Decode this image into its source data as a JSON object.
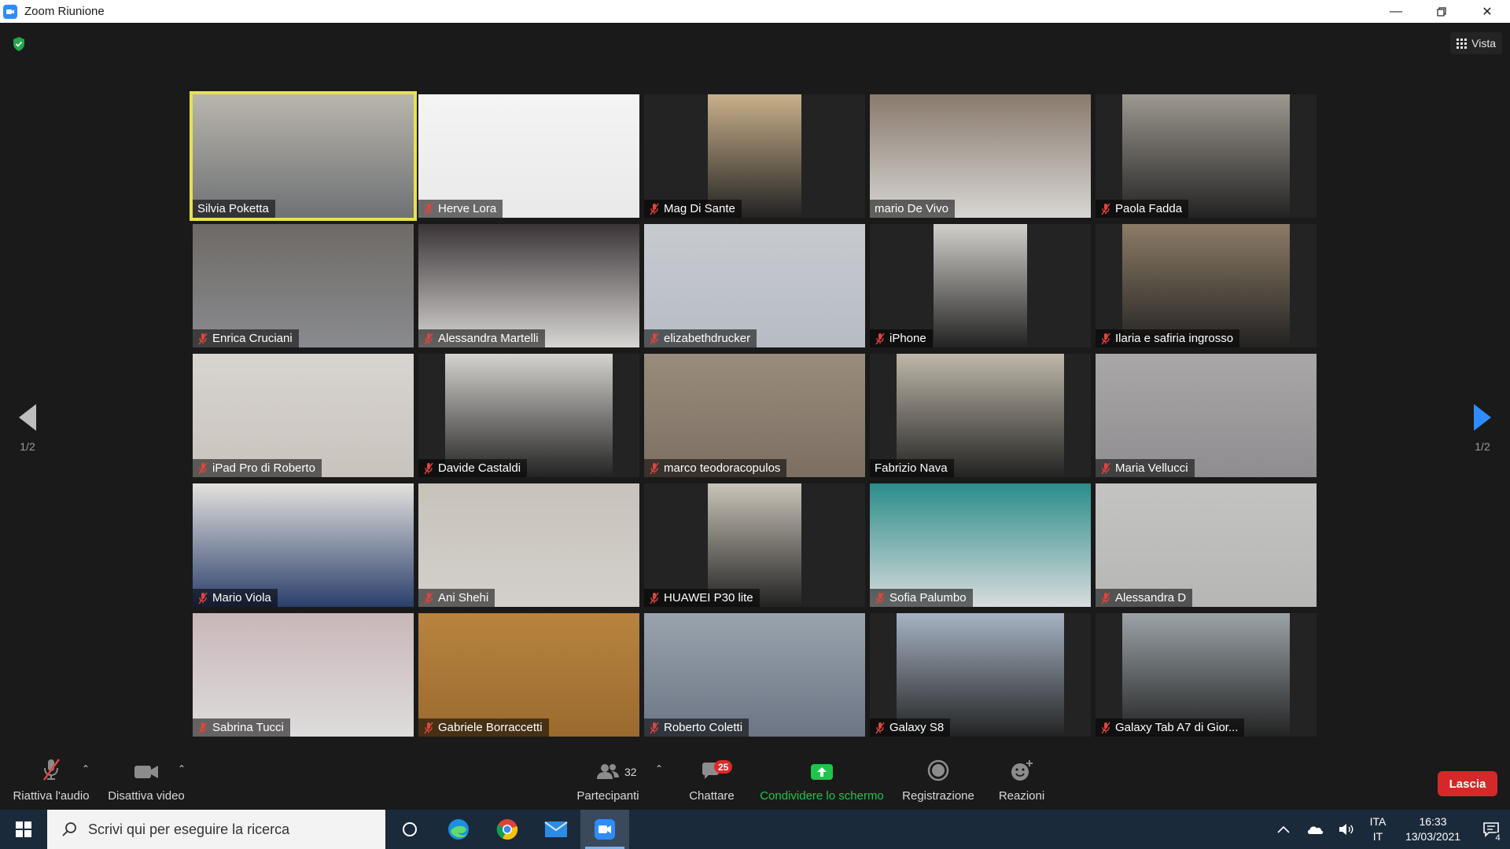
{
  "window": {
    "title": "Zoom Riunione"
  },
  "header": {
    "view_label": "Vista"
  },
  "pagination": {
    "left": "1/2",
    "right": "1/2"
  },
  "participants": [
    {
      "name": "Silvia Poketta",
      "muted": false,
      "active": true,
      "bg": "#6f7174",
      "scene": "#b9b6ad",
      "sceneLeft": 0,
      "sceneWidth": 100
    },
    {
      "name": "Herve Lora",
      "muted": true,
      "active": false,
      "bg": "#e9e9ea",
      "scene": "#f4f4f4",
      "sceneLeft": 0,
      "sceneWidth": 100
    },
    {
      "name": "Mag Di Sante",
      "muted": true,
      "active": false,
      "bg": "#232323",
      "scene": "#c9b18a",
      "sceneLeft": 29,
      "sceneWidth": 42
    },
    {
      "name": "mario De Vivo",
      "muted": false,
      "active": false,
      "bg": "#d6d6d2",
      "scene": "#8a7a6e",
      "sceneLeft": 0,
      "sceneWidth": 100
    },
    {
      "name": "Paola Fadda",
      "muted": true,
      "active": false,
      "bg": "#232323",
      "scene": "#9d9890",
      "sceneLeft": 12,
      "sceneWidth": 76
    },
    {
      "name": "Enrica Cruciani",
      "muted": true,
      "active": false,
      "bg": "#8a8b8f",
      "scene": "#6e6a66",
      "sceneLeft": 0,
      "sceneWidth": 100
    },
    {
      "name": "Alessandra Martelli",
      "muted": true,
      "active": false,
      "bg": "#d8d6d3",
      "scene": "#3a3436",
      "sceneLeft": 0,
      "sceneWidth": 100
    },
    {
      "name": "elizabethdrucker",
      "muted": true,
      "active": false,
      "bg": "#b7bcc4",
      "scene": "#c7cbd0",
      "sceneLeft": 0,
      "sceneWidth": 100
    },
    {
      "name": "iPhone",
      "muted": true,
      "active": false,
      "bg": "#232323",
      "scene": "#d2d0cb",
      "sceneLeft": 29,
      "sceneWidth": 42
    },
    {
      "name": "Ilaria e safiria ingrosso",
      "muted": true,
      "active": false,
      "bg": "#232323",
      "scene": "#8c7b66",
      "sceneLeft": 12,
      "sceneWidth": 76
    },
    {
      "name": "iPad Pro di Roberto",
      "muted": true,
      "active": false,
      "bg": "#c9c3bd",
      "scene": "#d8d4cf",
      "sceneLeft": 0,
      "sceneWidth": 100
    },
    {
      "name": "Davide Castaldi",
      "muted": true,
      "active": false,
      "bg": "#232323",
      "scene": "#d5d3cf",
      "sceneLeft": 12,
      "sceneWidth": 76
    },
    {
      "name": "marco teodoracopulos",
      "muted": true,
      "active": false,
      "bg": "#7c6f62",
      "scene": "#9a8c7c",
      "sceneLeft": 0,
      "sceneWidth": 100
    },
    {
      "name": "Fabrizio Nava",
      "muted": false,
      "active": false,
      "bg": "#232323",
      "scene": "#bfb8aa",
      "sceneLeft": 12,
      "sceneWidth": 76
    },
    {
      "name": "Maria Vellucci",
      "muted": true,
      "active": false,
      "bg": "#8f8d8f",
      "scene": "#a9a7a8",
      "sceneLeft": 0,
      "sceneWidth": 100
    },
    {
      "name": "Mario Viola",
      "muted": true,
      "active": false,
      "bg": "#2b3f6b",
      "scene": "#e4e2df",
      "sceneLeft": 0,
      "sceneWidth": 100
    },
    {
      "name": "Ani Shehi",
      "muted": true,
      "active": false,
      "bg": "#d3d0cb",
      "scene": "#c7c2ba",
      "sceneLeft": 0,
      "sceneWidth": 100
    },
    {
      "name": "HUAWEI P30 lite",
      "muted": true,
      "active": false,
      "bg": "#232323",
      "scene": "#c9c4b8",
      "sceneLeft": 29,
      "sceneWidth": 42
    },
    {
      "name": "Sofia Palumbo",
      "muted": true,
      "active": false,
      "bg": "#d9dbdc",
      "scene": "#2a8d8a",
      "sceneLeft": 0,
      "sceneWidth": 100
    },
    {
      "name": "Alessandra D",
      "muted": true,
      "active": false,
      "bg": "#b6b7b5",
      "scene": "#c3c4c2",
      "sceneLeft": 0,
      "sceneWidth": 100
    },
    {
      "name": "Sabrina Tucci",
      "muted": true,
      "active": false,
      "bg": "#dedcdc",
      "scene": "#c9b7b9",
      "sceneLeft": 0,
      "sceneWidth": 100
    },
    {
      "name": "Gabriele Borraccetti",
      "muted": true,
      "active": false,
      "bg": "#9a6a2e",
      "scene": "#b8843f",
      "sceneLeft": 0,
      "sceneWidth": 100
    },
    {
      "name": "Roberto Coletti",
      "muted": true,
      "active": false,
      "bg": "#6b7584",
      "scene": "#9aa3ad",
      "sceneLeft": 0,
      "sceneWidth": 100
    },
    {
      "name": "Galaxy S8",
      "muted": true,
      "active": false,
      "bg": "#232323",
      "scene": "#a6b3c4",
      "sceneLeft": 12,
      "sceneWidth": 76
    },
    {
      "name": "Galaxy Tab A7 di Gior...",
      "muted": true,
      "active": false,
      "bg": "#232323",
      "scene": "#9ba3a8",
      "sceneLeft": 12,
      "sceneWidth": 76
    }
  ],
  "toolbar": {
    "audio_label": "Riattiva l'audio",
    "video_label": "Disattiva video",
    "participants_label": "Partecipanti",
    "participants_count": "32",
    "chat_label": "Chattare",
    "chat_badge": "25",
    "share_label": "Condividere lo schermo",
    "record_label": "Registrazione",
    "reactions_label": "Reazioni",
    "leave_label": "Lascia"
  },
  "taskbar": {
    "search_placeholder": "Scrivi qui per eseguire la ricerca",
    "lang_1": "ITA",
    "lang_2": "IT",
    "time": "16:33",
    "date": "13/03/2021",
    "notifications": "4"
  },
  "colors": {
    "accent": "#2d8cff",
    "share_green": "#1fc44c",
    "leave_red": "#d62828",
    "active_speaker": "#e6e34a",
    "mic_off": "#e0443e"
  }
}
